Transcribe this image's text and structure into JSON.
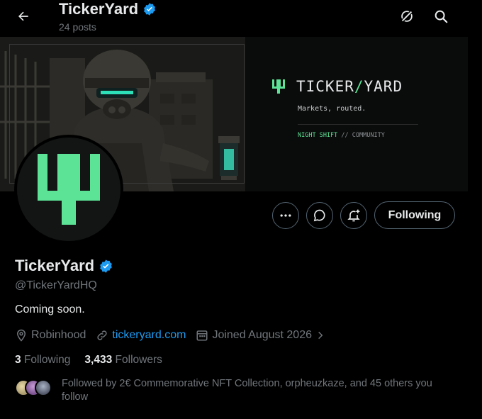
{
  "header": {
    "title": "TickerYard",
    "posts": "24 posts"
  },
  "banner": {
    "brand_left": "TICKER",
    "brand_slash": "/",
    "brand_right": "YARD",
    "tagline": "Markets, routed.",
    "night_shift": "NIGHT SHIFT",
    "community_rest": " // COMMUNITY",
    "accent": "#5de396"
  },
  "actions": {
    "following_label": "Following"
  },
  "profile": {
    "name": "TickerYard",
    "handle": "@TickerYardHQ",
    "bio": "Coming soon.",
    "location": "Robinhood",
    "website": "tickeryard.com",
    "joined": "Joined August 2026",
    "following_count": "3",
    "following_label": "Following",
    "followers_count": "3,433",
    "followers_label": "Followers",
    "followed_by": "Followed by 2€ Commemorative NFT Collection, orpheuzkaze, and 45 others you follow"
  },
  "colors": {
    "verified": "#1d9bf0",
    "link": "#1d9bf0",
    "muted": "#71767b",
    "brand_green": "#5de396"
  }
}
